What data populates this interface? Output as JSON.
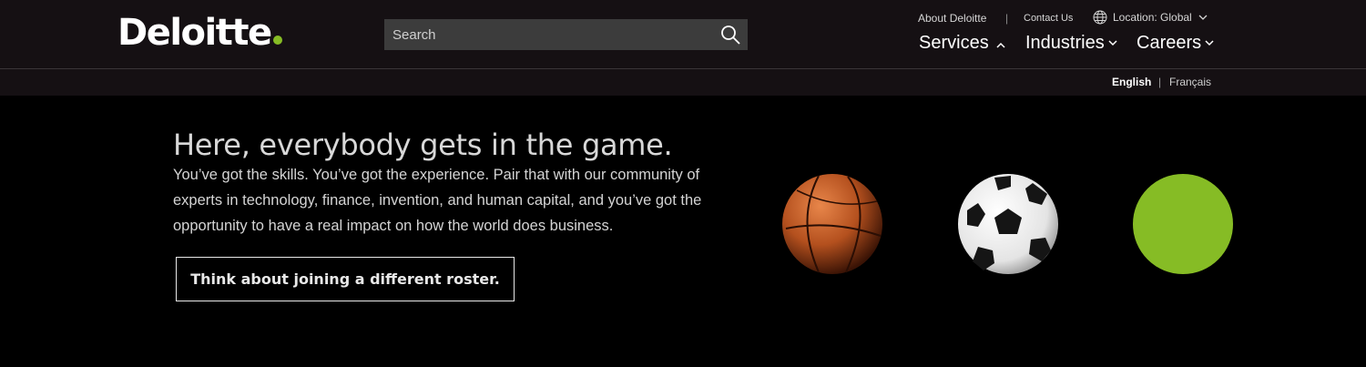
{
  "brand": {
    "name": "Deloitte",
    "dot_color": "#86bc25"
  },
  "search": {
    "placeholder": "Search"
  },
  "utility": {
    "about": "About Deloitte",
    "separator": "|",
    "contact": "Contact Us",
    "location": "Location: Global"
  },
  "nav": {
    "services": "Services",
    "industries": "Industries",
    "careers": "Careers"
  },
  "language": {
    "english": "English",
    "separator": "|",
    "french": "Français"
  },
  "hero": {
    "title": "Here, everybody gets in the game.",
    "body": "You’ve got the skills. You’ve got the experience. Pair that with our community of experts in technology, finance, invention, and human capital, and you’ve got the opportunity to have a real impact on how the world does business.",
    "cta": "Think about joining a different roster."
  },
  "images": {
    "icons": [
      "basketball-icon",
      "soccer-ball-icon",
      "green-ball-icon"
    ],
    "green": "#86bc25"
  }
}
